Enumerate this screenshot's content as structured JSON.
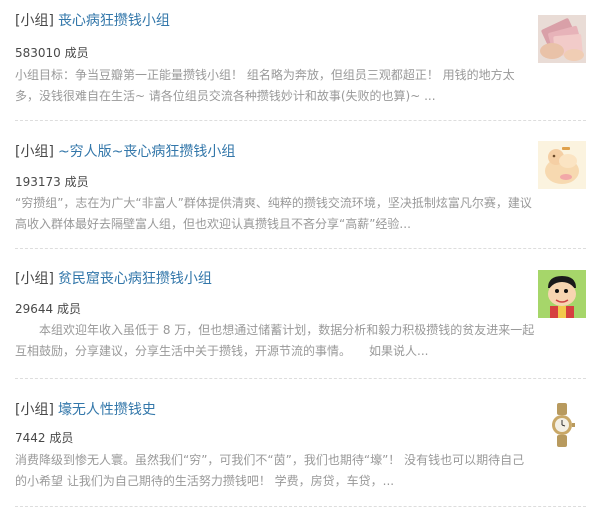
{
  "groups": [
    {
      "tag": "[小组]",
      "name": "丧心病狂攒钱小组",
      "members": "583010 成员",
      "description": "小组目标：争当豆瓣第一正能量攒钱小组！ 组名略为奔放，但组员三观都超正！ 用钱的地方太多，没钱很难自在生活~ 请各位组员交流各种攒钱妙计和故事(失败的也算)~ ..."
    },
    {
      "tag": "[小组]",
      "name": "~穷人版~丧心病狂攒钱小组",
      "members": "193173 成员",
      "description": "“穷攒组”，志在为广大“非富人”群体提供清爽、纯粹的攒钱交流环境，坚决抵制炫富凡尔赛，建议高收入群体最好去隔壁富人组，但也欢迎认真攒钱且不吝分享“高薪”经验..."
    },
    {
      "tag": "[小组]",
      "name": "贫民窟丧心病狂攒钱小组",
      "members": "29644 成员",
      "description": "　　本组欢迎年收入虽低于 8 万，但也想通过储蓄计划，数据分析和毅力积极攒钱的贫友进来一起互相鼓励，分享建议，分享生活中关于攒钱，开源节流的事情。　　如果说人..."
    },
    {
      "tag": "[小组]",
      "name": "壕无人性攒钱史",
      "members": "7442 成员",
      "description": "消费降级到惨无人寰。虽然我们“穷”，可我们不“茵”，我们也期待“壕”！ 没有钱也可以期待自己的小希望 让我们为自己期待的生活努力攒钱吧！ 学费，房贷，车贷，..."
    }
  ]
}
